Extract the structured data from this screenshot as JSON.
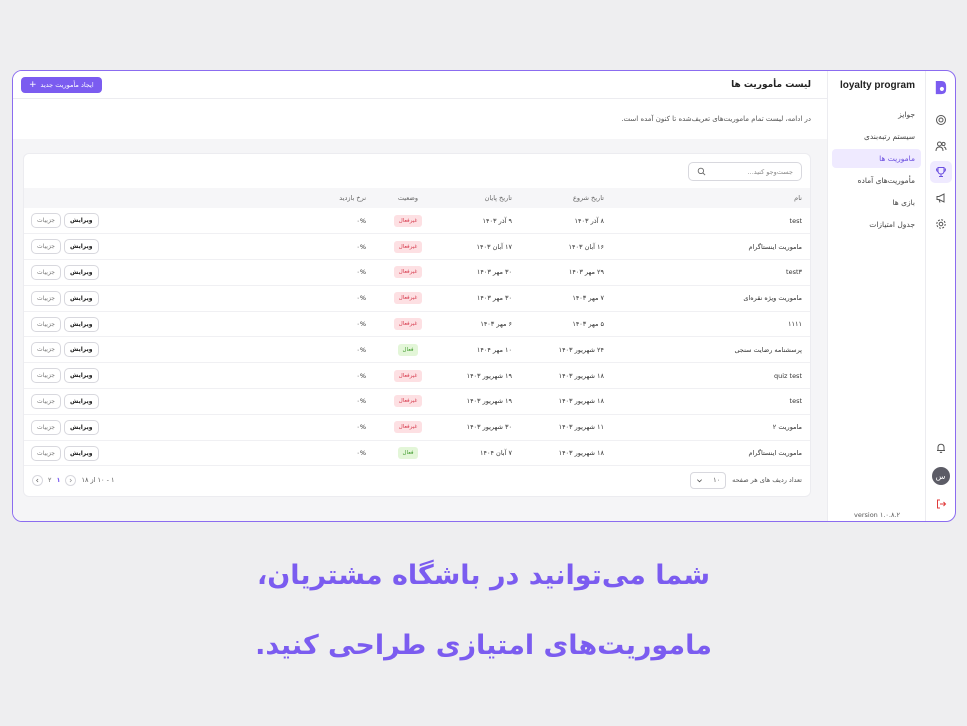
{
  "app": {
    "brand": "loyalty program",
    "version": "version ۱.۰.۸.۲",
    "avatar_text": "س"
  },
  "menu": [
    {
      "label": "جوایز"
    },
    {
      "label": "سیستم رتبه‌بندی"
    },
    {
      "label": "ماموریت ها",
      "active": true
    },
    {
      "label": "مأموریت‌های آماده"
    },
    {
      "label": "بازی ها"
    },
    {
      "label": "جدول امتیازات"
    }
  ],
  "header": {
    "title": "لیست مأموریت ها",
    "create_button": "ایجاد مأموریت جدید",
    "create_icon": "plus-icon",
    "description": "در ادامه، لیست تمام ماموریت‌های تعریف‌شده تا کنون آمده است."
  },
  "search": {
    "placeholder": "جست‌وجو کنید..."
  },
  "table": {
    "columns": [
      "نام",
      "تاریخ شروع",
      "تاریخ پایان",
      "وضعیت",
      "نرخ بازدید",
      ""
    ],
    "rows": [
      {
        "name": "test",
        "start": "۸ آذر ۱۴۰۳",
        "end": "۹ آذر ۱۴۰۳",
        "status": "غیرفعال",
        "active": false,
        "rate": "۰%"
      },
      {
        "name": "ماموریت اینستاگرام",
        "start": "۱۶ آبان ۱۴۰۳",
        "end": "۱۷ آبان ۱۴۰۳",
        "status": "غیرفعال",
        "active": false,
        "rate": "۰%"
      },
      {
        "name": "test۳",
        "start": "۲۹ مهر ۱۴۰۳",
        "end": "۳۰ مهر ۱۴۰۳",
        "status": "غیرفعال",
        "active": false,
        "rate": "۰%"
      },
      {
        "name": "ماموریت ویژه نقره‌ای",
        "start": "۷ مهر ۱۴۰۳",
        "end": "۳۰ مهر ۱۴۰۳",
        "status": "غیرفعال",
        "active": false,
        "rate": "۰%"
      },
      {
        "name": "۱۱۱۱",
        "start": "۵ مهر ۱۴۰۳",
        "end": "۶ مهر ۱۴۰۳",
        "status": "غیرفعال",
        "active": false,
        "rate": "۰%"
      },
      {
        "name": "پرسشنامه رضایت سنجی",
        "start": "۲۴ شهریور ۱۴۰۳",
        "end": "۱۰ مهر ۱۴۰۴",
        "status": "فعال",
        "active": true,
        "rate": "۰%"
      },
      {
        "name": "quiz test",
        "start": "۱۸ شهریور ۱۴۰۳",
        "end": "۱۹ شهریور ۱۴۰۳",
        "status": "غیرفعال",
        "active": false,
        "rate": "۰%"
      },
      {
        "name": "test",
        "start": "۱۸ شهریور ۱۴۰۳",
        "end": "۱۹ شهریور ۱۴۰۳",
        "status": "غیرفعال",
        "active": false,
        "rate": "۰%"
      },
      {
        "name": "ماموریت ۲",
        "start": "۱۱ شهریور ۱۴۰۳",
        "end": "۳۰ شهریور ۱۴۰۳",
        "status": "غیرفعال",
        "active": false,
        "rate": "۰%"
      },
      {
        "name": "ماموریت اینستاگرام",
        "start": "۱۸ شهریور ۱۴۰۳",
        "end": "۷ آبان ۱۴۰۴",
        "status": "فعال",
        "active": true,
        "rate": "۰%"
      }
    ],
    "detail_label": "جزییات",
    "edit_label": "ویرایش"
  },
  "footer": {
    "rows_per_page_label": "تعداد ردیف های هر صفحه",
    "rows_per_page_value": "۱۰",
    "range_text": "۱ - ۱۰ از ۱۸",
    "pages": [
      "۱",
      "۲"
    ],
    "current_page": "۱"
  },
  "caption": {
    "line1": "شما می‌توانید در باشگاه مشتریان،",
    "line2": "ماموریت‌های امتیازی طراحی کنید."
  },
  "colors": {
    "accent": "#7b5cf0",
    "inactive_badge_bg": "#fde0e3",
    "active_badge_bg": "#e3f6d8"
  },
  "icons": [
    "logo-icon",
    "coins-icon",
    "users-icon",
    "trophy-icon",
    "megaphone-icon",
    "gear-icon",
    "bell-icon",
    "logout-icon",
    "search-icon",
    "chevron-down-icon",
    "chevron-left-icon",
    "chevron-right-icon"
  ]
}
